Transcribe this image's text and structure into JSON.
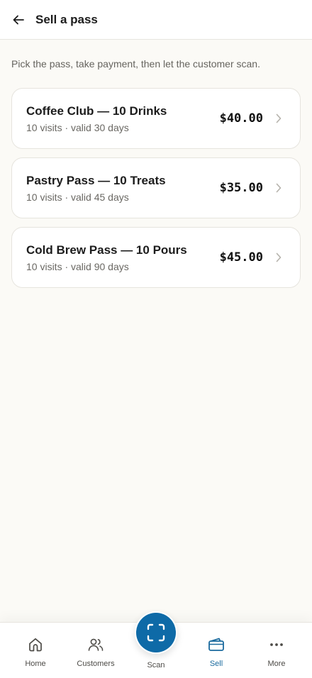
{
  "header": {
    "title": "Sell a pass",
    "back_icon": "arrow-left-icon"
  },
  "instructions": "Pick the pass, take payment, then let the customer scan.",
  "passes": [
    {
      "name": "Coffee Club — 10 Drinks",
      "meta": "10 visits · valid 30 days",
      "price": "$40.00"
    },
    {
      "name": "Pastry Pass — 10 Treats",
      "meta": "10 visits · valid 45 days",
      "price": "$35.00"
    },
    {
      "name": "Cold Brew Pass — 10 Pours",
      "meta": "10 visits · valid 90 days",
      "price": "$45.00"
    }
  ],
  "nav": {
    "home": "Home",
    "customers": "Customers",
    "scan": "Scan",
    "sell": "Sell",
    "more": "More",
    "active": "Sell"
  },
  "colors": {
    "accent": "#0e6aa7",
    "active_nav": "#1a6a9e",
    "background": "#fbfaf6"
  }
}
